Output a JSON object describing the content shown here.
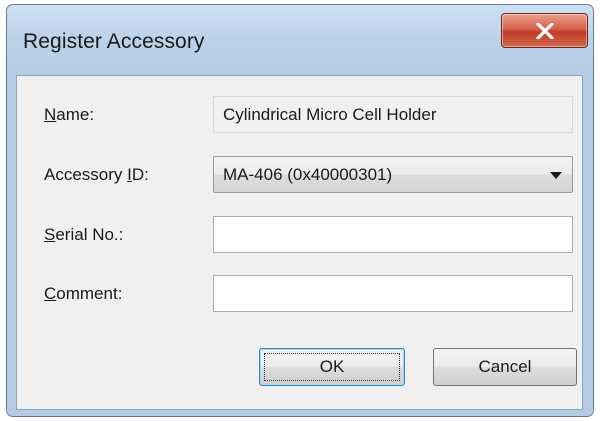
{
  "window": {
    "title": "Register Accessory",
    "close_glyph": "X",
    "close_icon": "close-icon"
  },
  "form": {
    "name": {
      "label_accel": "N",
      "label_rest": "ame:",
      "value": "Cylindrical Micro Cell Holder"
    },
    "accessory_id": {
      "label_pre": "Accessory ",
      "label_accel": "I",
      "label_rest": "D:",
      "selected": "MA-406 (0x40000301)",
      "arrow_icon": "dropdown-arrow-icon"
    },
    "serial_no": {
      "label_accel": "S",
      "label_rest": "erial No.:",
      "value": ""
    },
    "comment": {
      "label_accel": "C",
      "label_rest": "omment:",
      "value": ""
    }
  },
  "buttons": {
    "ok_label": "OK",
    "cancel_label": "Cancel"
  },
  "colors": {
    "titlebar": "#bed3ea",
    "close_button": "#c23b25",
    "dialog_background": "#f0f0f0",
    "ok_focus_border": "#3c7fb1"
  }
}
